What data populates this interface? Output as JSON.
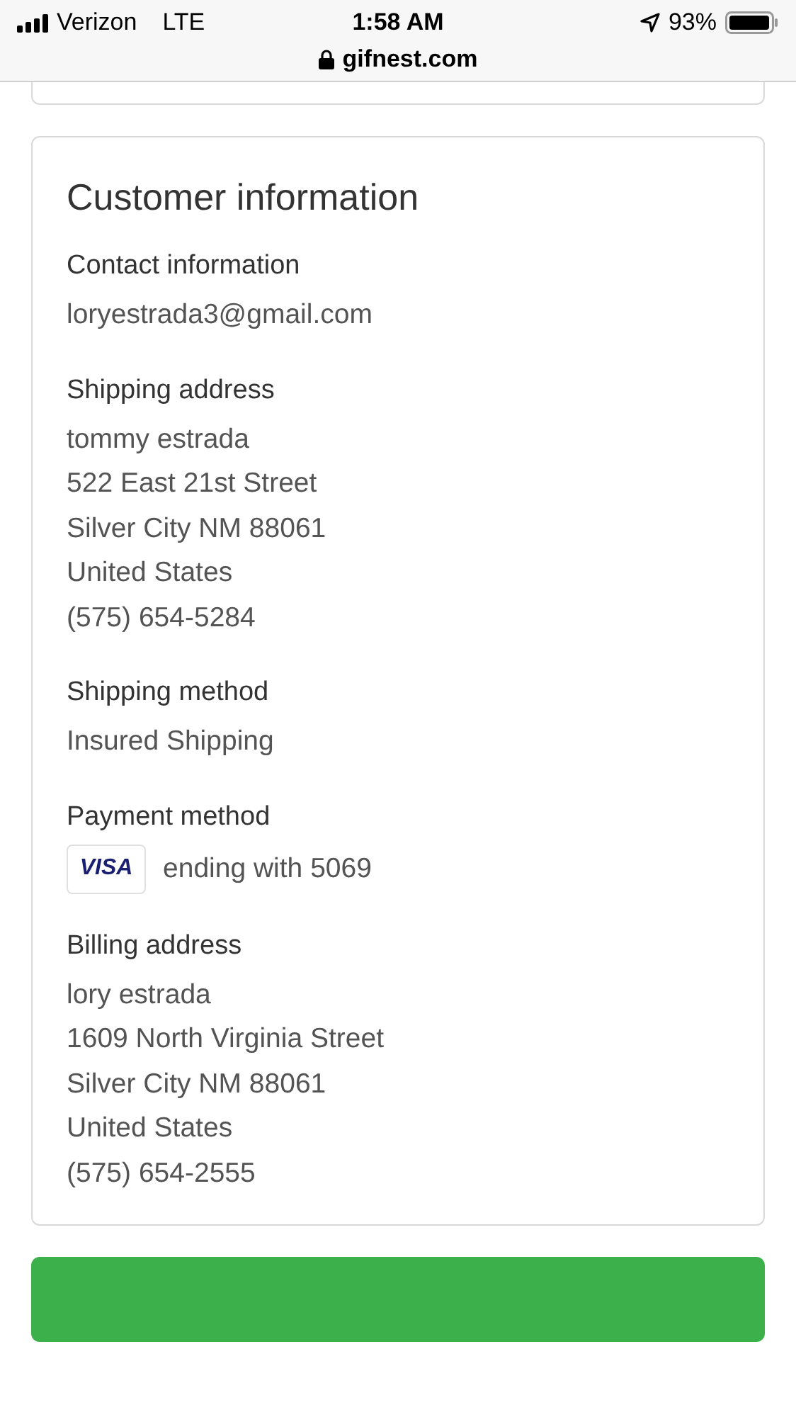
{
  "status_bar": {
    "carrier": "Verizon",
    "network": "LTE",
    "time": "1:58 AM",
    "url": "gifnest.com",
    "battery": "93%"
  },
  "card": {
    "title": "Customer information",
    "sections": [
      {
        "kind": "text",
        "title": "Contact information",
        "lines": [
          "loryestrada3@gmail.com"
        ]
      },
      {
        "kind": "text",
        "title": "Shipping address",
        "lines": [
          "tommy estrada",
          "522 East 21st Street",
          "Silver City NM 88061",
          "United States",
          "(575) 654-5284"
        ]
      },
      {
        "kind": "text",
        "title": "Shipping method",
        "lines": [
          "Insured Shipping"
        ]
      },
      {
        "kind": "payment",
        "title": "Payment method",
        "card_brand": "VISA",
        "lines": [
          "ending with 5069"
        ]
      },
      {
        "kind": "text",
        "title": "Billing address",
        "lines": [
          "lory estrada",
          "1609 North Virginia Street",
          "Silver City NM 88061",
          "United States",
          "(575) 654-2555"
        ]
      }
    ]
  }
}
